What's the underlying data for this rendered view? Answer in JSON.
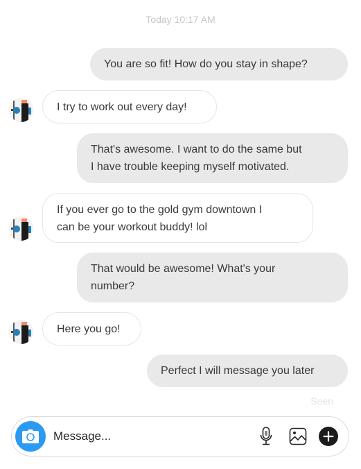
{
  "conversation": {
    "timestamp": "Today 10:17 AM",
    "messages": [
      {
        "direction": "sent",
        "text": "You are so fit! How do you stay in shape?"
      },
      {
        "direction": "received",
        "text": "I try to work out every day!"
      },
      {
        "direction": "sent",
        "text": "That's awesome. I want to do the same but I have trouble keeping myself motivated.",
        "lines": [
          "That's awesome. I want to do the same but",
          "I have trouble keeping myself motivated."
        ]
      },
      {
        "direction": "received",
        "text": "If you ever go to the gold gym downtown I can be your workout buddy! lol",
        "lines": [
          "If you ever go to the gold gym downtown I",
          "can be your workout buddy! lol"
        ]
      },
      {
        "direction": "sent",
        "text": "That would be awesome! What's your number?",
        "lines": [
          "That would be awesome! What's your",
          "number?"
        ]
      },
      {
        "direction": "received",
        "text": "Here you go!"
      },
      {
        "direction": "sent",
        "text": "Perfect I will message you later"
      }
    ],
    "seen_label": "Seen"
  },
  "composer": {
    "placeholder": "Message...",
    "value": "",
    "icons": {
      "camera": "camera-icon",
      "microphone": "microphone-icon",
      "image": "image-icon",
      "add": "plus-circle-icon"
    }
  },
  "colors": {
    "camera_button": "#2b9af3",
    "sent_bubble": "#e9e9e9",
    "received_border": "#e6e6e6",
    "timestamp": "#c7c7c7"
  }
}
